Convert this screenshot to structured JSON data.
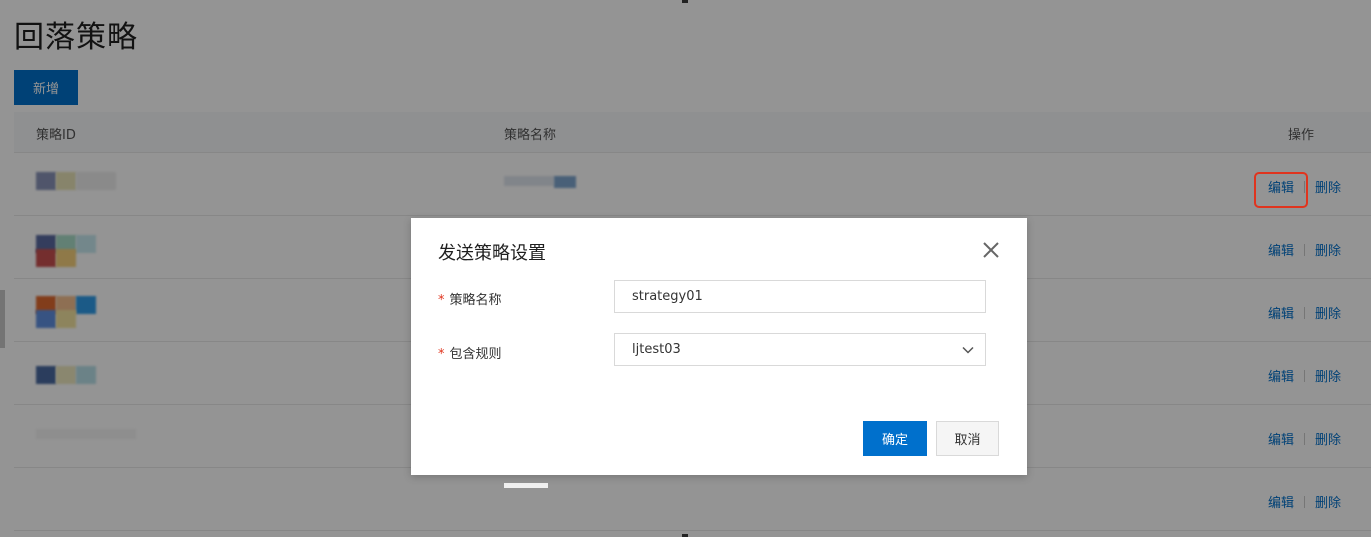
{
  "page": {
    "title": "回落策略",
    "add_button": "新增"
  },
  "table": {
    "columns": [
      "策略ID",
      "策略名称",
      "操作"
    ],
    "rows": [
      {
        "edit": "编辑",
        "delete": "删除"
      },
      {
        "edit": "编辑",
        "delete": "删除"
      },
      {
        "edit": "编辑",
        "delete": "删除"
      },
      {
        "edit": "编辑",
        "delete": "删除"
      },
      {
        "edit": "编辑",
        "delete": "删除"
      },
      {
        "edit": "编辑",
        "delete": "删除"
      }
    ]
  },
  "dialog": {
    "title": "发送策略设置",
    "required_mark": "*",
    "name_label": "策略名称",
    "name_value": "strategy01",
    "rule_label": "包含规则",
    "rule_value": "ljtest03",
    "ok_button": "确定",
    "cancel_button": "取消",
    "close_icon": "close-icon",
    "select_icon": "chevron-down-icon"
  },
  "colors": {
    "primary": "#0070cc",
    "highlight": "#e0341e",
    "required": "#e0341e"
  }
}
